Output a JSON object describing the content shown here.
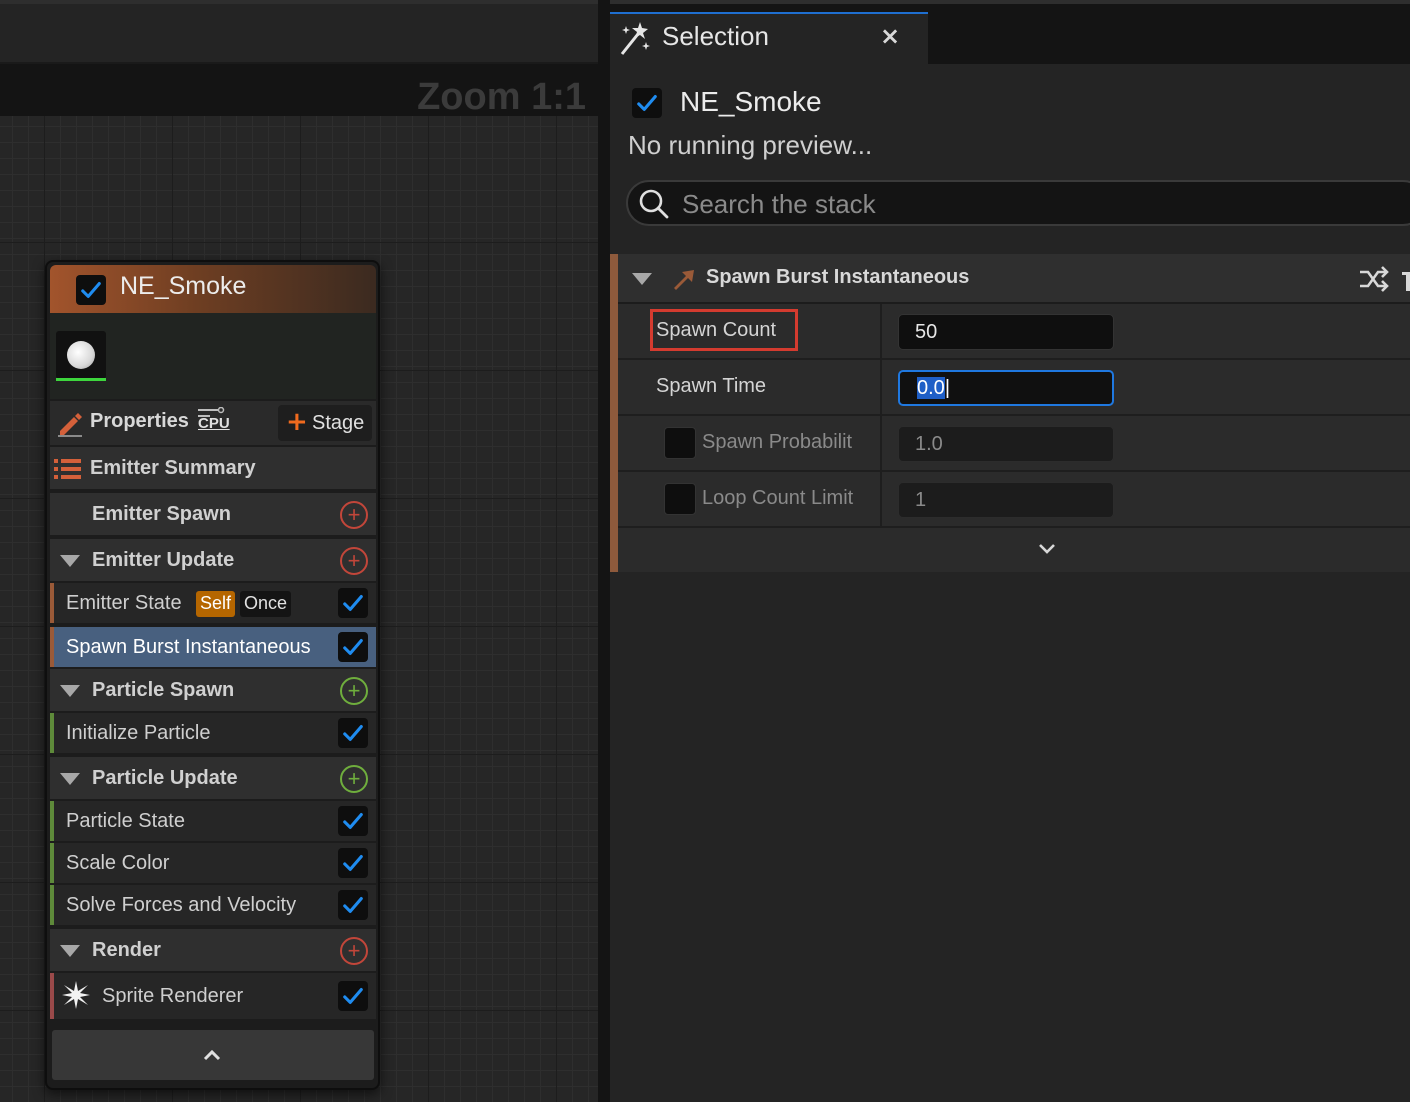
{
  "graph": {
    "zoom_label": "Zoom 1:1"
  },
  "node": {
    "title": "NE_Smoke",
    "enabled": true,
    "properties_label": "Properties",
    "sim_target_label": "CPU",
    "stage_button": {
      "plus": "+",
      "label": "Stage"
    },
    "sections": [
      {
        "label": "Emitter Summary"
      },
      {
        "label": "Emitter Spawn"
      },
      {
        "label": "Emitter Update"
      },
      {
        "label": "Particle Spawn"
      },
      {
        "label": "Particle Update"
      },
      {
        "label": "Render"
      }
    ],
    "modules": {
      "emitter_state": {
        "label": "Emitter State",
        "badges": [
          "Self",
          "Once"
        ],
        "enabled": true
      },
      "spawn_burst": {
        "label": "Spawn Burst Instantaneous",
        "enabled": true,
        "selected": true
      },
      "initialize_particle": {
        "label": "Initialize Particle",
        "enabled": true
      },
      "particle_state": {
        "label": "Particle State",
        "enabled": true
      },
      "scale_color": {
        "label": "Scale Color",
        "enabled": true
      },
      "solve_forces": {
        "label": "Solve Forces and Velocity",
        "enabled": true
      },
      "sprite_renderer": {
        "label": "Sprite Renderer",
        "enabled": true
      }
    },
    "add_button_symbol": "+"
  },
  "panel": {
    "tab": {
      "title": "Selection",
      "close": "×"
    },
    "selected": {
      "title": "NE_Smoke",
      "enabled": true,
      "status": "No running preview..."
    },
    "search": {
      "placeholder": "Search the stack",
      "value": ""
    },
    "module": {
      "title": "Spawn Burst Instantaneous",
      "params": [
        {
          "name": "Spawn Count",
          "value": "50",
          "highlighted": true
        },
        {
          "name": "Spawn Time",
          "value": "0.0",
          "focused": true
        },
        {
          "name": "Spawn Probabilit",
          "value": "1.0",
          "checkbox": false
        },
        {
          "name": "Loop Count Limit",
          "value": "1",
          "checkbox": false
        }
      ]
    }
  },
  "colors": {
    "accent": "#1f78e0",
    "check": "#1f8cf0",
    "node_header": "#a2542c",
    "highlight": "#d43b2f",
    "add_red": "#c2463a",
    "add_green": "#6fae3d",
    "badge_self": "#b56600",
    "selected_row": "#48607f"
  }
}
